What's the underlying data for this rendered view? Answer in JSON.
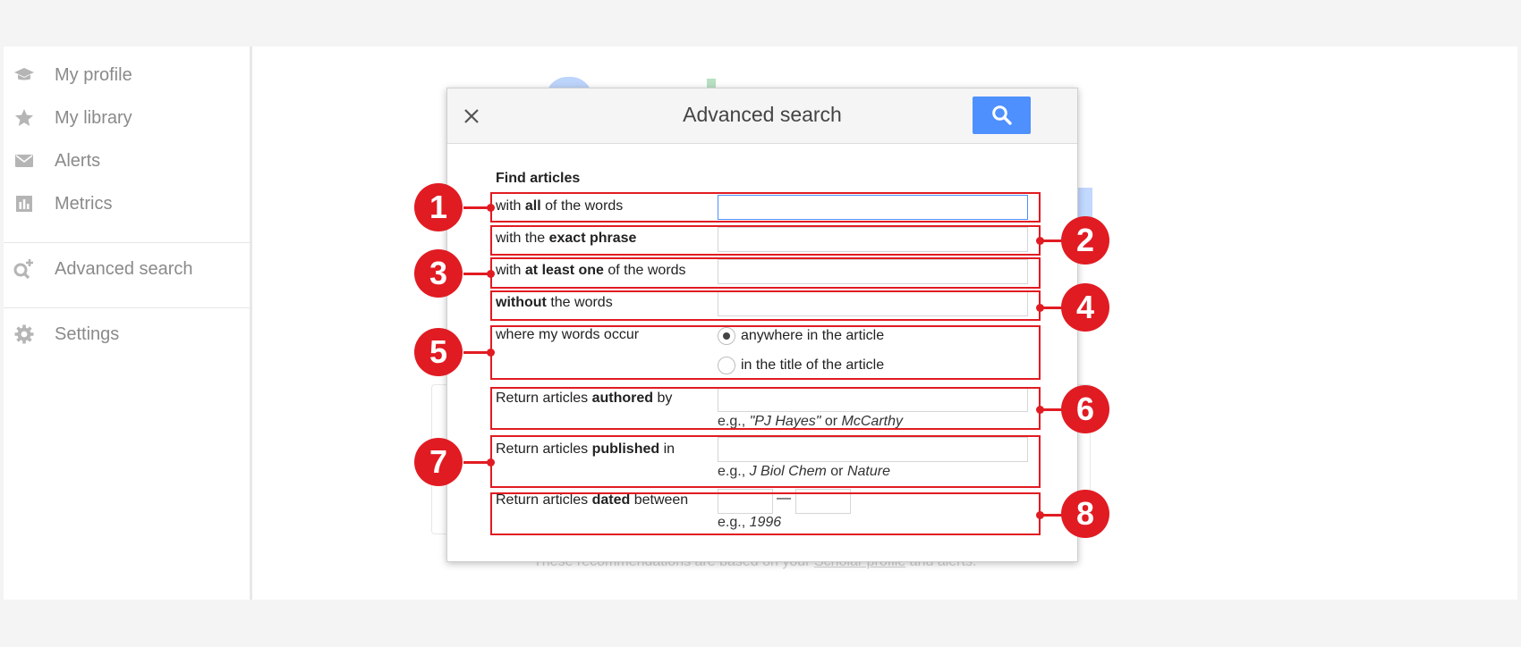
{
  "sidebar": {
    "items": [
      {
        "label": "My profile",
        "icon": "graduation-cap-icon"
      },
      {
        "label": "My library",
        "icon": "star-icon"
      },
      {
        "label": "Alerts",
        "icon": "envelope-icon"
      },
      {
        "label": "Metrics",
        "icon": "chart-icon"
      },
      {
        "label": "Advanced search",
        "icon": "search-plus-icon"
      },
      {
        "label": "Settings",
        "icon": "gear-icon"
      }
    ]
  },
  "background": {
    "footer_prefix": "These recommendations are based on your ",
    "footer_link": "Scholar profile",
    "footer_suffix": " and alerts."
  },
  "dialog": {
    "title": "Advanced search",
    "section_heading": "Find articles",
    "rows": {
      "all_words": {
        "pre": "with ",
        "bold": "all",
        "post": " of the words"
      },
      "exact_phrase": {
        "pre": "with the ",
        "bold": "exact phrase",
        "post": ""
      },
      "at_least_one": {
        "pre": "with ",
        "bold": "at least one",
        "post": " of the words"
      },
      "without": {
        "pre": "",
        "bold": "without",
        "post": " the words"
      },
      "occur": {
        "label": "where my words occur",
        "options": [
          "anywhere in the article",
          "in the title of the article"
        ],
        "selected": 0
      },
      "authored": {
        "pre": "Return articles ",
        "bold": "authored",
        "post": " by",
        "hint_pre": "e.g., ",
        "hint_i1": "\"PJ Hayes\"",
        "hint_mid": " or ",
        "hint_i2": "McCarthy"
      },
      "published": {
        "pre": "Return articles ",
        "bold": "published",
        "post": " in",
        "hint_pre": "e.g., ",
        "hint_i1": "J Biol Chem",
        "hint_mid": " or ",
        "hint_i2": "Nature"
      },
      "dated": {
        "pre": "Return articles ",
        "bold": "dated",
        "post": " between",
        "dash": "—",
        "hint_pre": "e.g., ",
        "hint_i1": "1996"
      }
    }
  },
  "annotations": {
    "color": "#e11b22",
    "numbers": [
      "1",
      "2",
      "3",
      "4",
      "5",
      "6",
      "7",
      "8"
    ]
  }
}
